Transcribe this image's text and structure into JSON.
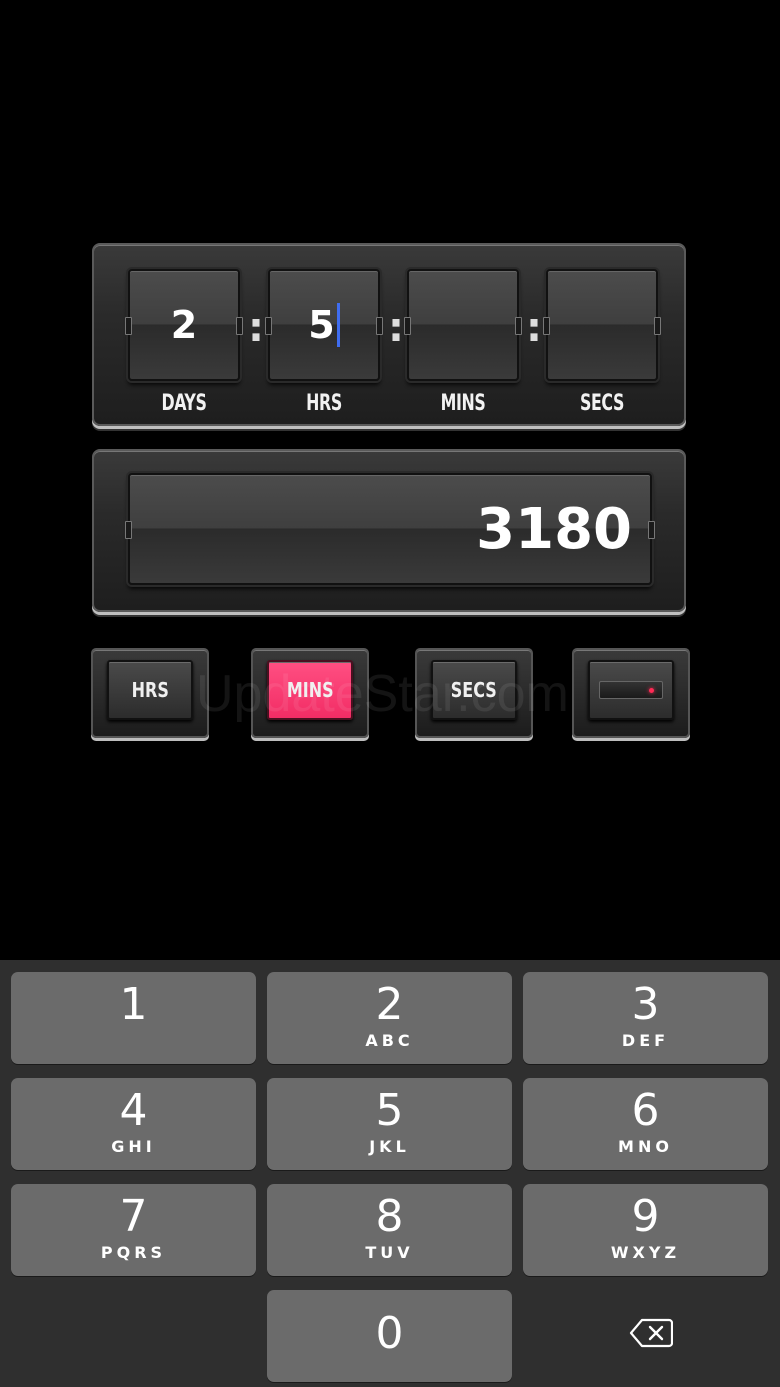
{
  "timer": {
    "days": {
      "value": "2",
      "label": "DAYS"
    },
    "hours": {
      "value": "5",
      "label": "HRS"
    },
    "minutes": {
      "value": "",
      "label": "MINS"
    },
    "seconds": {
      "value": "",
      "label": "SECS"
    },
    "separator": ":"
  },
  "result": {
    "value": "3180"
  },
  "unit_buttons": [
    {
      "label": "HRS",
      "active": false
    },
    {
      "label": "MINS",
      "active": true
    },
    {
      "label": "SECS",
      "active": false
    }
  ],
  "watermark": "UpdateStar.com",
  "keypad": {
    "keys": [
      {
        "num": "1",
        "letters": ""
      },
      {
        "num": "2",
        "letters": "ABC"
      },
      {
        "num": "3",
        "letters": "DEF"
      },
      {
        "num": "4",
        "letters": "GHI"
      },
      {
        "num": "5",
        "letters": "JKL"
      },
      {
        "num": "6",
        "letters": "MNO"
      },
      {
        "num": "7",
        "letters": "PQRS"
      },
      {
        "num": "8",
        "letters": "TUV"
      },
      {
        "num": "9",
        "letters": "WXYZ"
      },
      {
        "num": "0",
        "letters": ""
      }
    ],
    "delete_icon": "backspace-icon"
  },
  "colors": {
    "accent": "#f5346c",
    "caret": "#3f6df0",
    "keypad_bg": "#2f2f2f",
    "key_bg": "#6b6b6b"
  }
}
